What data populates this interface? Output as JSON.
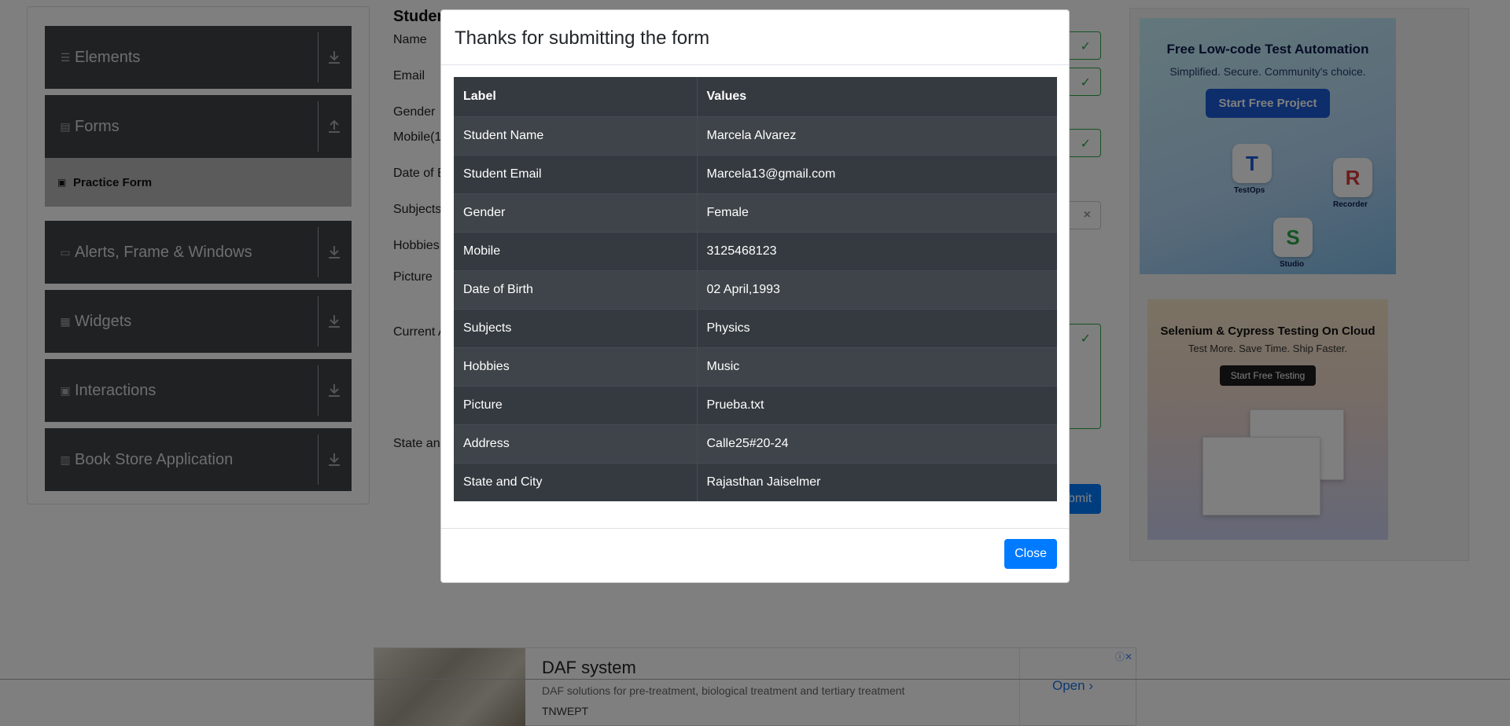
{
  "sidebar": {
    "groups": [
      {
        "label": "Elements",
        "icon": "hamburger-icon",
        "arrow": "download-icon"
      },
      {
        "label": "Forms",
        "icon": "document-icon",
        "arrow": "upload-icon"
      },
      {
        "label": "Alerts, Frame & Windows",
        "icon": "window-icon",
        "arrow": "download-icon"
      },
      {
        "label": "Widgets",
        "icon": "widgets-icon",
        "arrow": "download-icon"
      },
      {
        "label": "Interactions",
        "icon": "interactions-icon",
        "arrow": "download-icon"
      },
      {
        "label": "Book Store Application",
        "icon": "books-icon",
        "arrow": "download-icon"
      }
    ],
    "active_sub_item": "Practice Form"
  },
  "form": {
    "title_partial": "Studen",
    "labels": {
      "name": "Name",
      "email": "Email",
      "gender": "Gender",
      "mobile": "Mobile(1",
      "dob": "Date of B",
      "subjects": "Subjects",
      "hobbies": "Hobbies",
      "picture": "Picture",
      "address": "Current A",
      "state": "State and"
    },
    "submit_partial": "bmit",
    "clear_glyph": "×"
  },
  "ads": {
    "ad1": {
      "title": "Free Low-code Test Automation",
      "subtitle": "Simplified. Secure. Community's choice.",
      "button": "Start Free Project",
      "tiles": [
        "TestOps",
        "Recorder",
        "Studio"
      ]
    },
    "ad2": {
      "title": "Selenium & Cypress Testing On Cloud",
      "subtitle": "Test More. Save Time. Ship Faster.",
      "button": "Start Free Testing"
    },
    "bottom": {
      "title": "DAF system",
      "description": "DAF solutions for pre-treatment, biological treatment and tertiary treatment",
      "source": "TNWEPT",
      "open": "Open"
    }
  },
  "modal": {
    "title": "Thanks for submitting the form",
    "table": {
      "headers": [
        "Label",
        "Values"
      ],
      "rows": [
        {
          "label": "Student Name",
          "value": "Marcela Alvarez"
        },
        {
          "label": "Student Email",
          "value": "Marcela13@gmail.com"
        },
        {
          "label": "Gender",
          "value": "Female"
        },
        {
          "label": "Mobile",
          "value": "3125468123"
        },
        {
          "label": "Date of Birth",
          "value": "02 April,1993"
        },
        {
          "label": "Subjects",
          "value": "Physics"
        },
        {
          "label": "Hobbies",
          "value": "Music"
        },
        {
          "label": "Picture",
          "value": "Prueba.txt"
        },
        {
          "label": "Address",
          "value": "Calle25#20-24"
        },
        {
          "label": "State and City",
          "value": "Rajasthan Jaiselmer"
        }
      ]
    },
    "close_label": "Close"
  },
  "colors": {
    "accent": "#007bff",
    "table_dark": "#343a40",
    "sidebar_dark": "#3e4246",
    "valid_green": "#28a745"
  }
}
